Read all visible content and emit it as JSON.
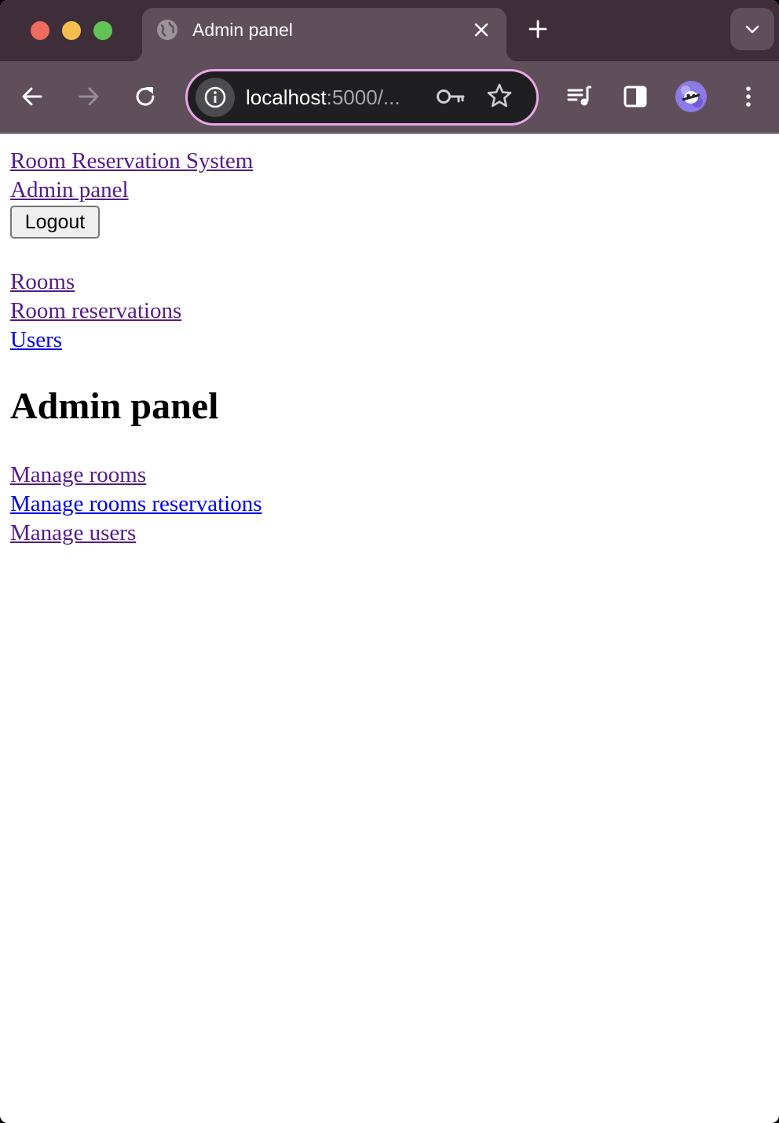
{
  "browser": {
    "tab_title": "Admin panel",
    "url_host": "localhost",
    "url_rest": ":5000/..."
  },
  "header": {
    "brand_link": "Room Reservation System",
    "admin_link": "Admin panel",
    "logout_button": "Logout"
  },
  "nav": {
    "items": [
      {
        "label": "Rooms",
        "visited": true
      },
      {
        "label": "Room reservations",
        "visited": true
      },
      {
        "label": "Users",
        "visited": false
      }
    ]
  },
  "main": {
    "title": "Admin panel",
    "links": [
      {
        "label": "Manage rooms",
        "visited": true
      },
      {
        "label": "Manage rooms reservations",
        "visited": false
      },
      {
        "label": "Manage users",
        "visited": true
      }
    ]
  },
  "colors": {
    "visited_link": "#551a8b",
    "unvisited_link": "#0000ee",
    "omnibox_focus_ring": "#e9a6e4",
    "tabstrip": "#3d2e3a",
    "toolbar": "#5f4f5b"
  }
}
